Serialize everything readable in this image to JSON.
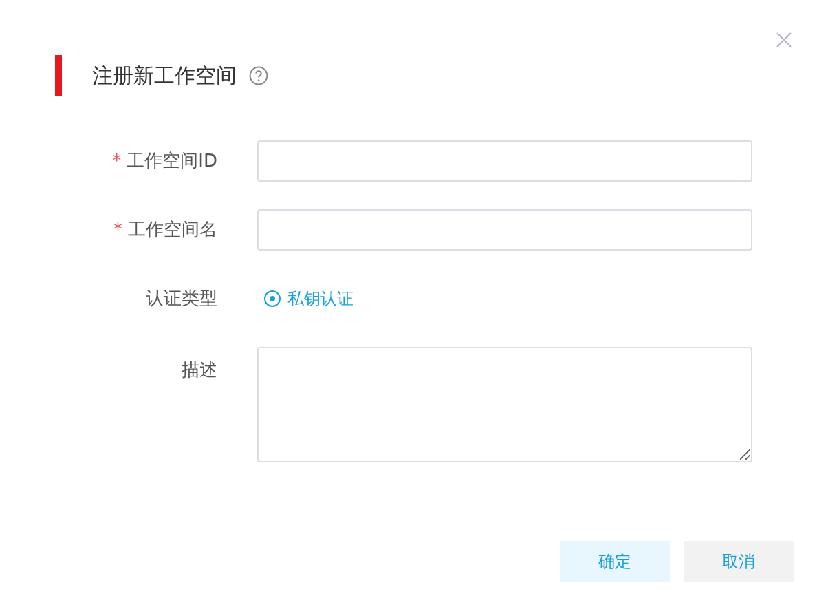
{
  "dialog": {
    "title": "注册新工作空间"
  },
  "fields": [
    {
      "kind": "text",
      "label": "工作空间ID",
      "required_mark": "*"
    },
    {
      "kind": "text",
      "label": "工作空间名",
      "required_mark": "*"
    },
    {
      "kind": "radio",
      "label": "认证类型",
      "options": [
        {
          "label": "私钥认证",
          "selected": true
        }
      ]
    },
    {
      "kind": "textarea",
      "label": "描述"
    }
  ],
  "buttons": [
    {
      "label": "确定",
      "kind": "primary"
    },
    {
      "label": "取消",
      "kind": "secondary"
    }
  ]
}
